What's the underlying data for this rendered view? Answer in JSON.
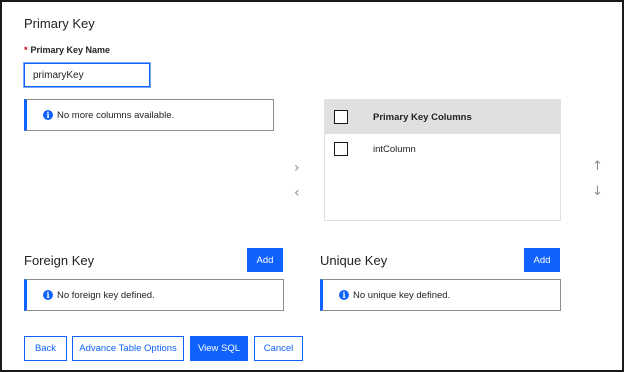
{
  "primary_key": {
    "title": "Primary Key",
    "name_label": "Primary Key Name",
    "required_mark": "*",
    "name_value": "primaryKey",
    "available_info": "No more columns available.",
    "table_header": "Primary Key Columns",
    "columns": [
      {
        "name": "intColumn",
        "checked": false
      }
    ]
  },
  "icons": {
    "info": "i",
    "move_right": "›",
    "move_left": "‹",
    "move_up": "↑",
    "move_down": "↓"
  },
  "foreign_key": {
    "title": "Foreign Key",
    "add_label": "Add",
    "info": "No foreign key defined."
  },
  "unique_key": {
    "title": "Unique Key",
    "add_label": "Add",
    "info": "No unique key defined."
  },
  "footer": {
    "back_label": "Back",
    "advance_label": "Advance Table Options",
    "view_sql_label": "View SQL",
    "cancel_label": "Cancel"
  },
  "colors": {
    "primary": "#0f62fe",
    "required": "#d0021b",
    "header_bg": "#e0e0e0"
  }
}
